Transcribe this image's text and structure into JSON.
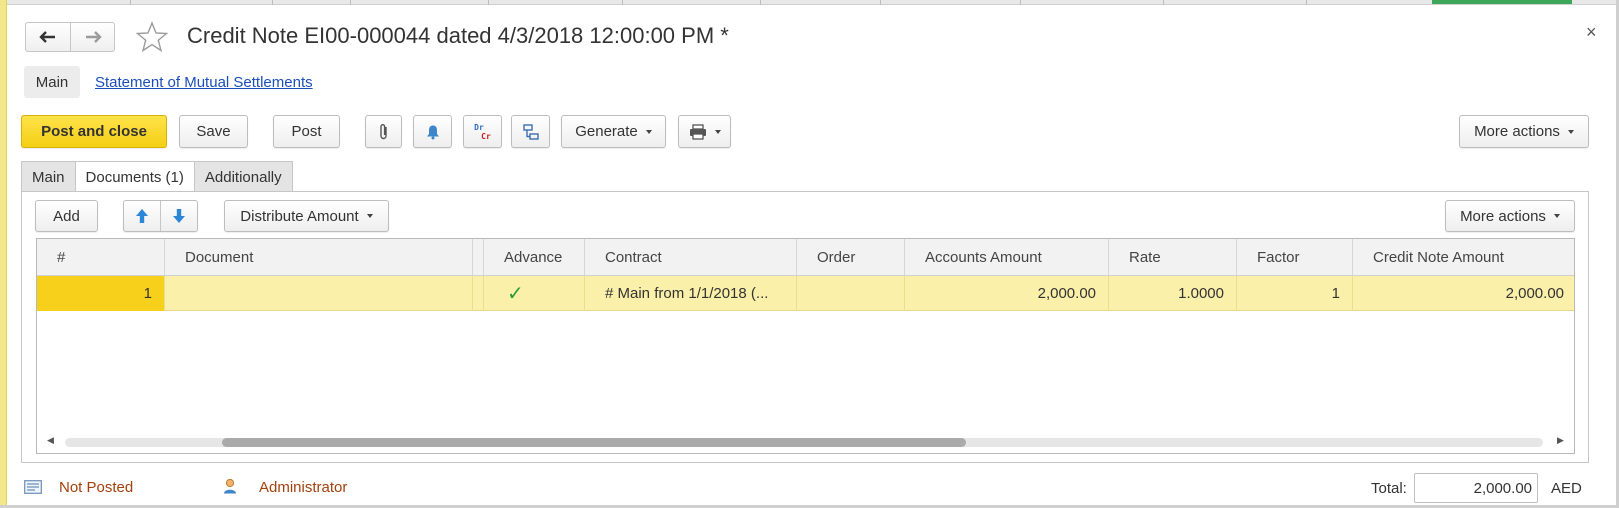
{
  "window": {
    "title": "Credit Note EI00-000044 dated 4/3/2018 12:00:00 PM *",
    "close_glyph": "×"
  },
  "nav_links": {
    "main": "Main",
    "statement": "Statement of Mutual Settlements"
  },
  "toolbar": {
    "post_and_close": "Post and close",
    "save": "Save",
    "post": "Post",
    "drcr_top": "Dr",
    "drcr_bottom": "Cr",
    "generate": "Generate",
    "more_actions": "More actions"
  },
  "form_tabs": [
    {
      "label": "Main"
    },
    {
      "label": "Documents (1)"
    },
    {
      "label": "Additionally"
    }
  ],
  "table_toolbar": {
    "add": "Add",
    "distribute_amount": "Distribute Amount",
    "more_actions": "More actions"
  },
  "table": {
    "columns": [
      "#",
      "Document",
      "Advance",
      "Contract",
      "Order",
      "Accounts Amount",
      "Rate",
      "Factor",
      "Credit Note Amount"
    ],
    "rows": [
      {
        "num": "1",
        "document": "",
        "advance": "✓",
        "contract": "# Main from 1/1/2018 (...",
        "order": "",
        "accounts_amount": "2,000.00",
        "rate": "1.0000",
        "factor": "1",
        "credit_note_amount": "2,000.00"
      }
    ]
  },
  "footer": {
    "status": "Not Posted",
    "user": "Administrator",
    "total_label": "Total:",
    "total_value": "2,000.00",
    "currency": "AED"
  },
  "colors": {
    "accent_yellow": "#f4cf14",
    "selected_row": "#fbf0a9",
    "link_blue": "#1a4fbb",
    "status_red": "#a1410d",
    "check_green": "#2e9b3a"
  },
  "icons": {
    "back": "arrow-left-icon",
    "forward": "arrow-right-icon",
    "favorite": "star-icon",
    "attach": "paperclip-icon",
    "reminder": "bell-icon",
    "drcr": "dr-cr-icon",
    "structure": "structure-icon",
    "print": "printer-icon",
    "move_up": "arrow-up-icon",
    "move_down": "arrow-down-icon",
    "status": "document-status-icon",
    "user": "user-icon"
  }
}
